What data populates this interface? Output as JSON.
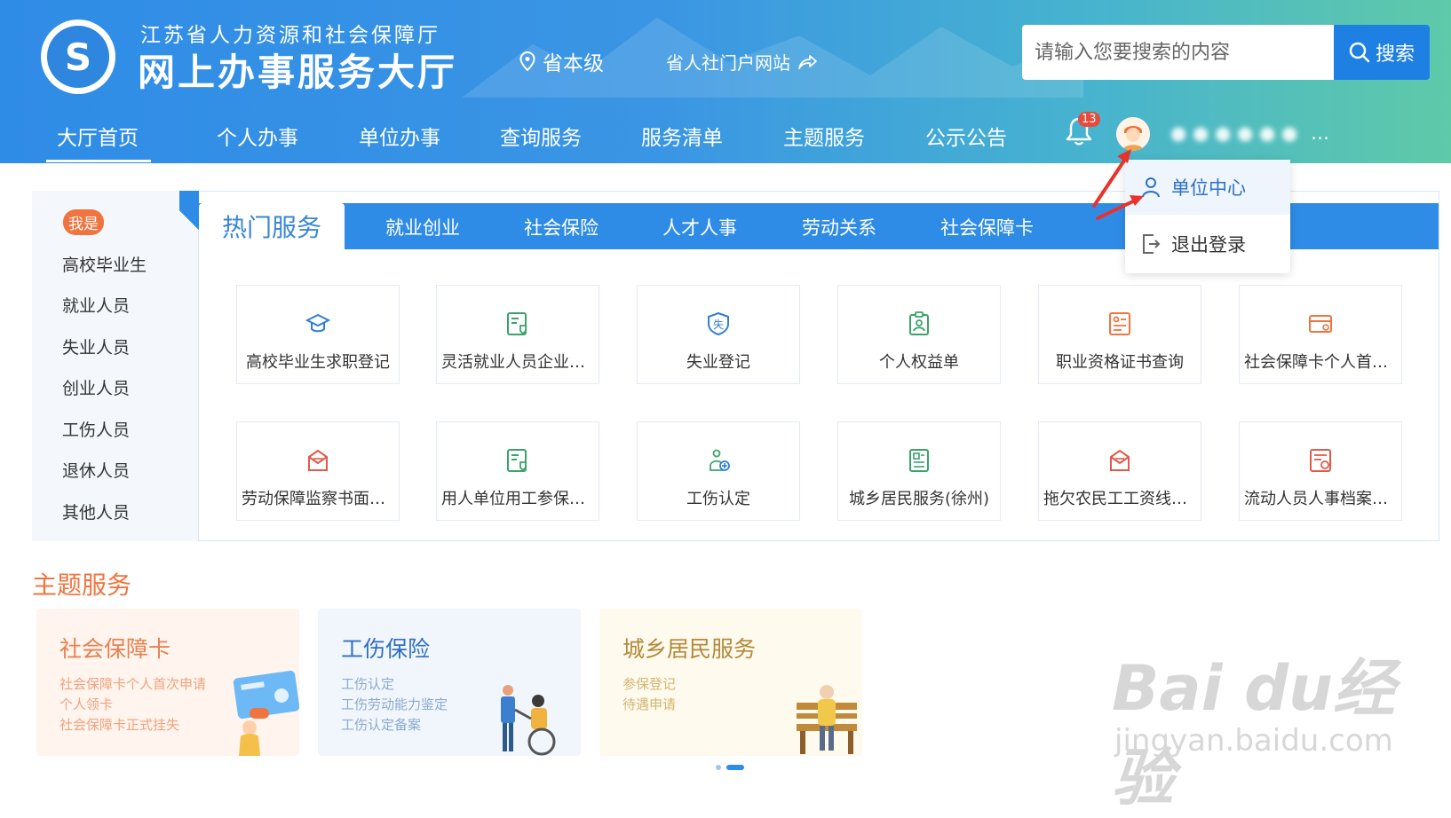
{
  "header": {
    "org_name": "江苏省人力资源和社会保障厅",
    "site_title": "网上办事服务大厅",
    "region": "省本级",
    "portal_link": "省人社门户网站",
    "search_placeholder": "请输入您要搜索的内容",
    "search_button": "搜索",
    "notification_count": "13",
    "username_dots": "…"
  },
  "nav": {
    "items": [
      "大厅首页",
      "个人办事",
      "单位办事",
      "查询服务",
      "服务清单",
      "主题服务",
      "公示公告"
    ],
    "active": "大厅首页"
  },
  "user_menu": {
    "items": [
      "单位中心",
      "退出登录"
    ]
  },
  "sidebar": {
    "badge": "我是",
    "items": [
      "高校毕业生",
      "就业人员",
      "失业人员",
      "创业人员",
      "工伤人员",
      "退休人员",
      "其他人员"
    ]
  },
  "service_tabs": [
    "热门服务",
    "就业创业",
    "社会保险",
    "人才人事",
    "劳动关系",
    "社会保障卡"
  ],
  "services": [
    {
      "label": "高校毕业生求职登记",
      "icon": "graduation-cap-icon"
    },
    {
      "label": "灵活就业人员企业职工基本养老保险参保登记",
      "icon": "id-card-shield-icon"
    },
    {
      "label": "失业登记",
      "icon": "shield-shi-icon"
    },
    {
      "label": "个人权益单",
      "icon": "clipboard-person-icon"
    },
    {
      "label": "职业资格证书查询",
      "icon": "certificate-icon"
    },
    {
      "label": "社会保障卡个人首次申领",
      "icon": "card-icon"
    },
    {
      "label": "劳动保障监察书面投诉",
      "icon": "mail-box-icon"
    },
    {
      "label": "用人单位用工参保登记",
      "icon": "id-card-shield-icon"
    },
    {
      "label": "工伤认定",
      "icon": "injury-icon"
    },
    {
      "label": "城乡居民服务(徐州)",
      "icon": "document-icon"
    },
    {
      "label": "拖欠农民工工资线索反映",
      "icon": "mail-box-icon"
    },
    {
      "label": "流动人员人事档案查询",
      "icon": "archive-icon"
    }
  ],
  "theme": {
    "title": "主题服务",
    "cards": [
      {
        "title": "社会保障卡",
        "links": [
          "社会保障卡个人首次申请",
          "个人领卡",
          "社会保障卡正式挂失"
        ]
      },
      {
        "title": "工伤保险",
        "links": [
          "工伤认定",
          "工伤劳动能力鉴定",
          "工伤认定备案"
        ]
      },
      {
        "title": "城乡居民服务",
        "links": [
          "参保登记",
          "待遇申请"
        ]
      }
    ]
  },
  "watermark": {
    "main": "Bai du经验",
    "sub": "jingyan.baidu.com"
  },
  "colors": {
    "primary": "#2f8ce6",
    "accent": "#f0743f",
    "alert": "#e84a3c"
  }
}
